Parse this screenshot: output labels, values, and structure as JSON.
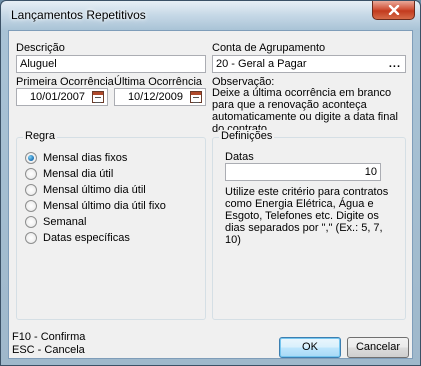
{
  "window": {
    "title": "Lançamentos Repetitivos"
  },
  "form": {
    "descricao_label": "Descrição",
    "descricao_value": "Aluguel",
    "conta_label": "Conta de Agrupamento",
    "conta_value": "20 - Geral a Pagar",
    "conta_lookup_label": "...",
    "primeira_label": "Primeira Ocorrência",
    "primeira_value": "10/01/2007",
    "ultima_label": "Última Ocorrência",
    "ultima_value": "10/12/2009",
    "observacao_label": "Observação:",
    "observacao_text": "Deixe a última ocorrência em branco para que a renovação aconteça automaticamente ou digite a data final do contrato."
  },
  "regra": {
    "title": "Regra",
    "options": [
      {
        "label": "Mensal dias fixos",
        "checked": true
      },
      {
        "label": "Mensal dia útil",
        "checked": false
      },
      {
        "label": "Mensal último dia útil",
        "checked": false
      },
      {
        "label": "Mensal último dia útil fixo",
        "checked": false
      },
      {
        "label": "Semanal",
        "checked": false
      },
      {
        "label": "Datas específicas",
        "checked": false
      }
    ]
  },
  "definicoes": {
    "title": "Definições",
    "datas_label": "Datas",
    "datas_value": "10",
    "help_text": "Utilize este critério para contratos como Energia Elétrica, Água e Esgoto, Telefones etc. Digite os dias separados por \",\" (Ex.: 5, 7, 10)"
  },
  "footer": {
    "hotkey_confirm": "F10 - Confirma",
    "hotkey_cancel": "ESC - Cancela",
    "ok_label": "OK",
    "cancel_label": "Cancelar"
  },
  "icons": {
    "close": "close-icon",
    "calendar": "calendar-icon",
    "radio": "radio-button"
  }
}
